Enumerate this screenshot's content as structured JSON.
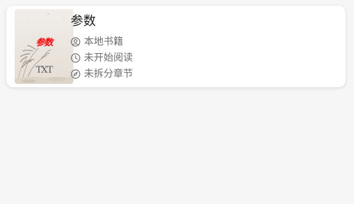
{
  "book": {
    "title": "参数",
    "cover": {
      "title": "参数",
      "tag": "TXT",
      "title_color": "#ff0a0a"
    },
    "meta": [
      {
        "icon": "person-icon",
        "text": "本地书籍"
      },
      {
        "icon": "clock-icon",
        "text": "未开始阅读"
      },
      {
        "icon": "compass-icon",
        "text": "未拆分章节"
      }
    ]
  },
  "colors": {
    "background": "#f6f6f7",
    "card": "#ffffff",
    "title_text": "#1c1c1c",
    "meta_text": "#6d6d6d"
  }
}
